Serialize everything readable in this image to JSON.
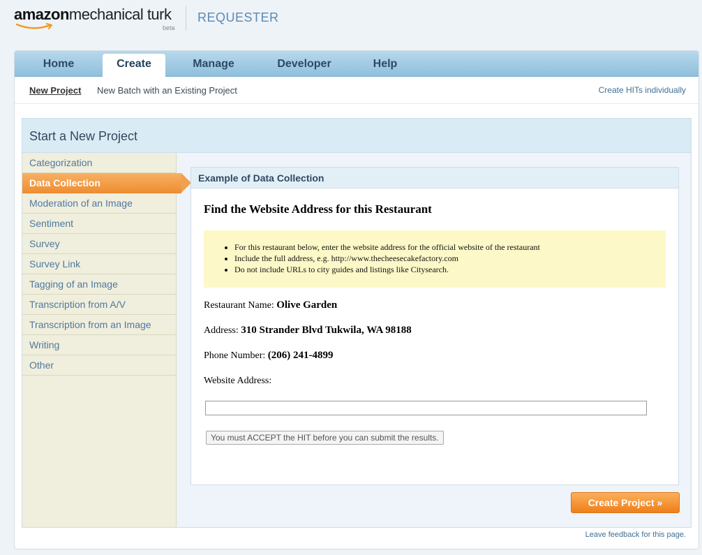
{
  "header": {
    "logo_amazon": "amazon",
    "logo_mturk": "mechanical turk",
    "logo_beta": "beta",
    "section": "REQUESTER"
  },
  "nav": {
    "tabs": [
      {
        "label": "Home"
      },
      {
        "label": "Create",
        "active": true
      },
      {
        "label": "Manage"
      },
      {
        "label": "Developer"
      },
      {
        "label": "Help"
      }
    ]
  },
  "subnav": {
    "links": [
      {
        "label": "New Project",
        "active": true
      },
      {
        "label": "New Batch with an Existing Project"
      }
    ],
    "right_link": "Create HITs individually"
  },
  "panel": {
    "title": "Start a New Project",
    "templates": [
      {
        "label": "Categorization"
      },
      {
        "label": "Data Collection",
        "active": true
      },
      {
        "label": "Moderation of an Image"
      },
      {
        "label": "Sentiment"
      },
      {
        "label": "Survey"
      },
      {
        "label": "Survey Link"
      },
      {
        "label": "Tagging of an Image"
      },
      {
        "label": "Transcription from A/V"
      },
      {
        "label": "Transcription from an Image"
      },
      {
        "label": "Writing"
      },
      {
        "label": "Other"
      }
    ]
  },
  "example": {
    "header": "Example of Data Collection",
    "hit_title": "Find the Website Address for this Restaurant",
    "instructions": [
      "For this restaurant below, enter the website address for the official website of the restaurant",
      "Include the full address, e.g. http://www.thecheesecakefactory.com",
      "Do not include URLs to city guides and listings like Citysearch."
    ],
    "restaurant_label": "Restaurant Name: ",
    "restaurant_value": "Olive Garden",
    "address_label": "Address: ",
    "address_value": "310 Strander Blvd Tukwila, WA 98188",
    "phone_label": "Phone Number: ",
    "phone_value": "(206) 241-4899",
    "website_label": "Website Address:",
    "website_value": "",
    "accept_button": "You must ACCEPT the HIT before you can submit the results."
  },
  "actions": {
    "create_project": "Create Project »"
  },
  "footer": {
    "feedback": "Leave feedback for this page."
  },
  "colors": {
    "accent_orange": "#ef7f1a",
    "nav_blue": "#8fbfdc",
    "link_blue": "#4f79a0",
    "instructions_bg": "#fdf8c8"
  }
}
